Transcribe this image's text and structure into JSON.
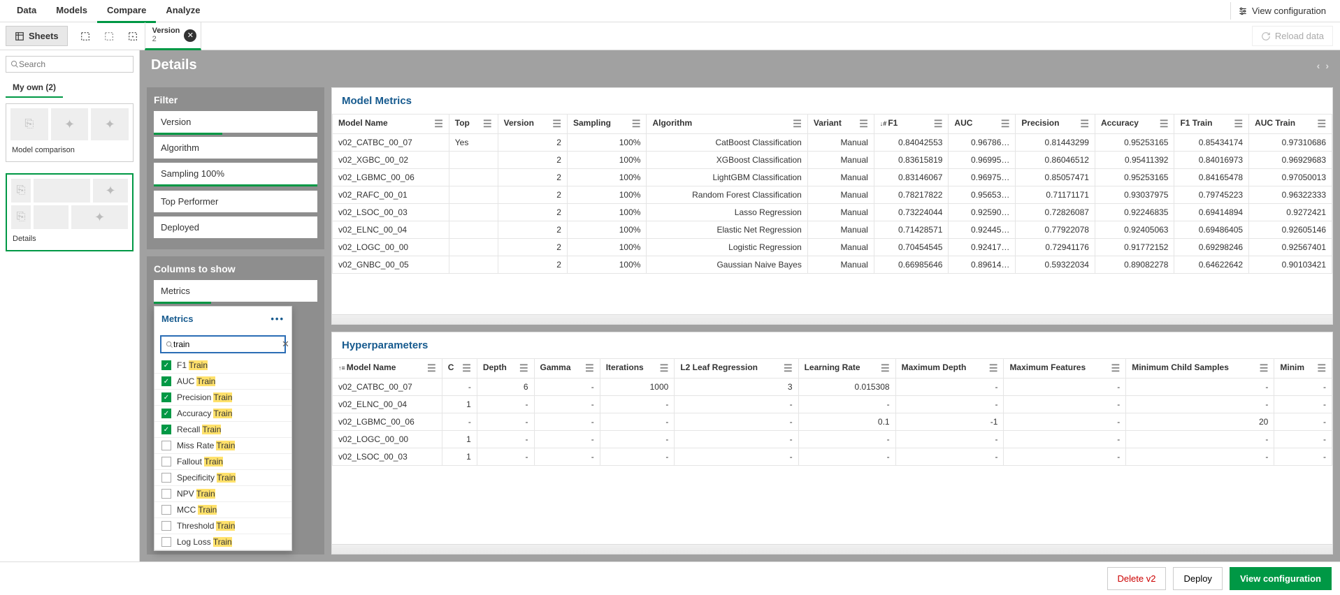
{
  "nav": {
    "tabs": [
      "Data",
      "Models",
      "Compare",
      "Analyze"
    ],
    "active": 2,
    "view_config": "View configuration"
  },
  "secondbar": {
    "sheets": "Sheets",
    "chip_title": "Version",
    "chip_sub": "2",
    "reload": "Reload data"
  },
  "sidebar": {
    "search_ph": "Search",
    "myown": "My own (2)",
    "thumbs": [
      "Model comparison",
      "Details"
    ]
  },
  "detailsbar": "Details",
  "filter": {
    "title": "Filter",
    "items": [
      {
        "label": "Version",
        "active": "partial7"
      },
      {
        "label": "Algorithm",
        "active": ""
      },
      {
        "label": "Sampling 100%",
        "active": "active"
      },
      {
        "label": "Top Performer",
        "active": ""
      },
      {
        "label": "Deployed",
        "active": ""
      }
    ]
  },
  "cols": {
    "title": "Columns to show",
    "items": [
      {
        "label": "Metrics",
        "active": "partial3"
      }
    ]
  },
  "dropdown": {
    "header": "Metrics",
    "search": "train",
    "items": [
      {
        "pre": "F1 ",
        "hl": "Train",
        "checked": true
      },
      {
        "pre": "AUC ",
        "hl": "Train",
        "checked": true
      },
      {
        "pre": "Precision ",
        "hl": "Train",
        "checked": true
      },
      {
        "pre": "Accuracy ",
        "hl": "Train",
        "checked": true
      },
      {
        "pre": "Recall ",
        "hl": "Train",
        "checked": true
      },
      {
        "pre": "Miss Rate ",
        "hl": "Train",
        "checked": false
      },
      {
        "pre": "Fallout ",
        "hl": "Train",
        "checked": false
      },
      {
        "pre": "Specificity ",
        "hl": "Train",
        "checked": false
      },
      {
        "pre": "NPV ",
        "hl": "Train",
        "checked": false
      },
      {
        "pre": "MCC ",
        "hl": "Train",
        "checked": false
      },
      {
        "pre": "Threshold ",
        "hl": "Train",
        "checked": false
      },
      {
        "pre": "Log Loss ",
        "hl": "Train",
        "checked": false
      }
    ]
  },
  "metrics": {
    "title": "Model Metrics",
    "headers": [
      "Model Name",
      "Top",
      "Version",
      "Sampling",
      "Algorithm",
      "Variant",
      "F1",
      "AUC",
      "Precision",
      "Accuracy",
      "F1 Train",
      "AUC Train"
    ],
    "sortcol": 6,
    "rows": [
      [
        "v02_CATBC_00_07",
        "Yes",
        "2",
        "100%",
        "CatBoost Classification",
        "Manual",
        "0.84042553",
        "0.96786…",
        "0.81443299",
        "0.95253165",
        "0.85434174",
        "0.97310686"
      ],
      [
        "v02_XGBC_00_02",
        "",
        "2",
        "100%",
        "XGBoost Classification",
        "Manual",
        "0.83615819",
        "0.96995…",
        "0.86046512",
        "0.95411392",
        "0.84016973",
        "0.96929683"
      ],
      [
        "v02_LGBMC_00_06",
        "",
        "2",
        "100%",
        "LightGBM Classification",
        "Manual",
        "0.83146067",
        "0.96975…",
        "0.85057471",
        "0.95253165",
        "0.84165478",
        "0.97050013"
      ],
      [
        "v02_RAFC_00_01",
        "",
        "2",
        "100%",
        "Random Forest Classification",
        "Manual",
        "0.78217822",
        "0.95653…",
        "0.71171171",
        "0.93037975",
        "0.79745223",
        "0.96322333"
      ],
      [
        "v02_LSOC_00_03",
        "",
        "2",
        "100%",
        "Lasso Regression",
        "Manual",
        "0.73224044",
        "0.92590…",
        "0.72826087",
        "0.92246835",
        "0.69414894",
        "0.9272421"
      ],
      [
        "v02_ELNC_00_04",
        "",
        "2",
        "100%",
        "Elastic Net Regression",
        "Manual",
        "0.71428571",
        "0.92445…",
        "0.77922078",
        "0.92405063",
        "0.69486405",
        "0.92605146"
      ],
      [
        "v02_LOGC_00_00",
        "",
        "2",
        "100%",
        "Logistic Regression",
        "Manual",
        "0.70454545",
        "0.92417…",
        "0.72941176",
        "0.91772152",
        "0.69298246",
        "0.92567401"
      ],
      [
        "v02_GNBC_00_05",
        "",
        "2",
        "100%",
        "Gaussian Naive Bayes",
        "Manual",
        "0.66985646",
        "0.89614…",
        "0.59322034",
        "0.89082278",
        "0.64622642",
        "0.90103421"
      ]
    ]
  },
  "hyper": {
    "title": "Hyperparameters",
    "headers": [
      "Model Name",
      "C",
      "Depth",
      "Gamma",
      "Iterations",
      "L2 Leaf Regression",
      "Learning Rate",
      "Maximum Depth",
      "Maximum Features",
      "Minimum Child Samples",
      "Minim"
    ],
    "rows": [
      [
        "v02_CATBC_00_07",
        "-",
        "6",
        "-",
        "1000",
        "3",
        "0.015308",
        "-",
        "-",
        "-",
        "-"
      ],
      [
        "v02_ELNC_00_04",
        "1",
        "-",
        "-",
        "-",
        "-",
        "-",
        "-",
        "-",
        "-",
        "-"
      ],
      [
        "v02_LGBMC_00_06",
        "-",
        "-",
        "-",
        "-",
        "-",
        "0.1",
        "-1",
        "-",
        "20",
        "-"
      ],
      [
        "v02_LOGC_00_00",
        "1",
        "-",
        "-",
        "-",
        "-",
        "-",
        "-",
        "-",
        "-",
        "-"
      ],
      [
        "v02_LSOC_00_03",
        "1",
        "-",
        "-",
        "-",
        "-",
        "-",
        "-",
        "-",
        "-",
        "-"
      ]
    ]
  },
  "footer": {
    "delete": "Delete v2",
    "deploy": "Deploy",
    "view": "View configuration"
  }
}
